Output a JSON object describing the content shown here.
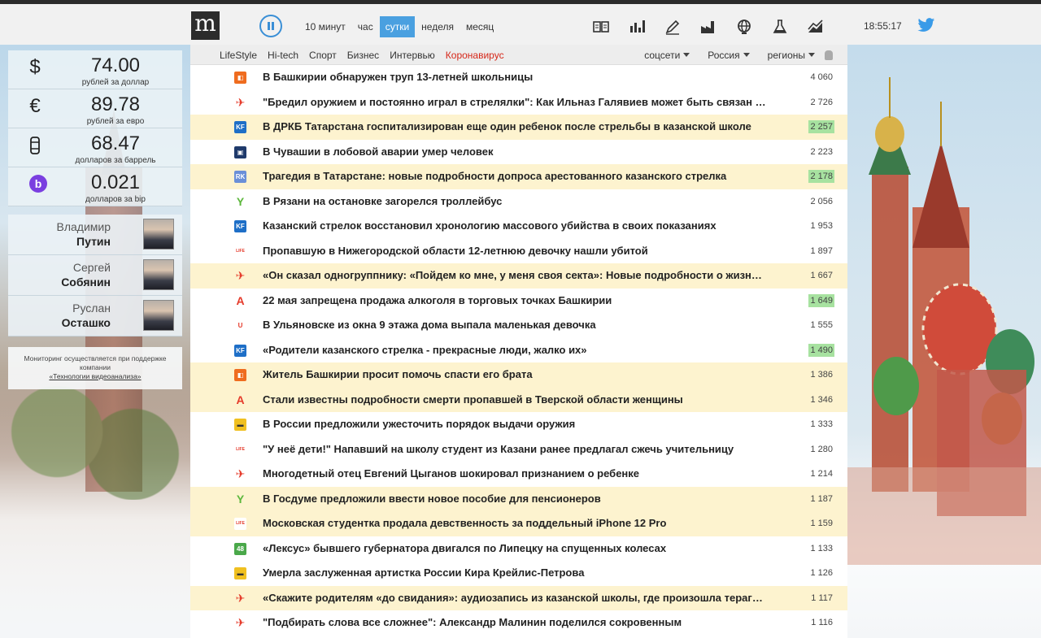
{
  "topbar": {
    "logo": "m",
    "periods": [
      "10 минут",
      "час",
      "сутки",
      "неделя",
      "месяц"
    ],
    "active_period": "сутки",
    "category_icons": [
      "newspaper-icon",
      "chart-bars-icon",
      "pen-icon",
      "factory-icon",
      "globe-icon",
      "flask-icon",
      "trend-icon"
    ],
    "time": "18:55:17"
  },
  "rates": [
    {
      "icon": "dollar",
      "symbol": "$",
      "value": "74.00",
      "caption": "рублей за доллар"
    },
    {
      "icon": "euro",
      "symbol": "€",
      "value": "89.78",
      "caption": "рублей за евро"
    },
    {
      "icon": "barrel",
      "symbol": "🛢",
      "value": "68.47",
      "caption": "долларов за баррель"
    },
    {
      "icon": "bip",
      "symbol": "b",
      "value": "0.021",
      "caption": "долларов за bip"
    }
  ],
  "people": [
    {
      "first": "Владимир",
      "last": "Путин"
    },
    {
      "first": "Сергей",
      "last": "Собянин"
    },
    {
      "first": "Руслан",
      "last": "Осташко"
    }
  ],
  "support": {
    "text": "Мониторинг осуществляется при поддержке компании",
    "link": "«Технологии видеоанализа»"
  },
  "subnav": {
    "categories": [
      "LifeStyle",
      "Hi-tech",
      "Спорт",
      "Бизнес",
      "Интервью"
    ],
    "highlight": "Коронавирус",
    "filters": [
      "соцсети",
      "Россия",
      "регионы"
    ]
  },
  "colors": {
    "accent": "#4aa0e0",
    "highlight_row": "#fdf3cf",
    "count_badge": "#a7e2a0",
    "hot": "#d6281a"
  },
  "news": [
    {
      "source": "square-orange",
      "title": "В Башкирии обнаружен труп 13-летней школьницы",
      "count": "4 060",
      "hl": false,
      "green": false
    },
    {
      "source": "bird-red",
      "title": "\"Бредил оружием и постоянно играл в стрелялки\": Как Ильназ Галявиев может быть связан со…",
      "count": "2 726",
      "hl": false,
      "green": false
    },
    {
      "source": "kf",
      "title": "В ДРКБ Татарстана госпитализирован еще один ребенок после стрельбы в казанской школе",
      "count": "2 257",
      "hl": true,
      "green": true
    },
    {
      "source": "save",
      "title": "В Чувашии в лобовой аварии умер человек",
      "count": "2 223",
      "hl": false,
      "green": false
    },
    {
      "source": "rk",
      "title": "Трагедия в Татарстане: новые подробности допроса арестованного казанского стрелка",
      "count": "2 178",
      "hl": true,
      "green": true
    },
    {
      "source": "y-green",
      "title": "В Рязани на остановке загорелся троллейбус",
      "count": "2 056",
      "hl": false,
      "green": false
    },
    {
      "source": "kf",
      "title": "Казанский стрелок восстановил хронологию массового убийства в своих показаниях",
      "count": "1 953",
      "hl": false,
      "green": false
    },
    {
      "source": "life",
      "title": "Пропавшую в Нижегородской области 12-летнюю девочку нашли убитой",
      "count": "1 897",
      "hl": false,
      "green": false
    },
    {
      "source": "bird-red",
      "title": "«Он сказал одногруппнику: «Пойдем ко мне, у меня своя секта»: Новые подробности о жизни …",
      "count": "1 667",
      "hl": true,
      "green": false
    },
    {
      "source": "a-red",
      "title": "22 мая запрещена продажа алкоголя в торговых точках Башкирии",
      "count": "1 649",
      "hl": false,
      "green": true
    },
    {
      "source": "u-red",
      "title": "В Ульяновске из окна 9 этажа дома выпала маленькая девочка",
      "count": "1 555",
      "hl": false,
      "green": false
    },
    {
      "source": "kf",
      "title": "«Родители казанского стрелка - прекрасные люди, жалко их»",
      "count": "1 490",
      "hl": false,
      "green": true
    },
    {
      "source": "square-orange",
      "title": "Житель Башкирии просит помочь спасти его брата",
      "count": "1 386",
      "hl": true,
      "green": false
    },
    {
      "source": "a-red",
      "title": "Стали известны подробности смерти пропавшей в Тверской области женщины",
      "count": "1 346",
      "hl": true,
      "green": false
    },
    {
      "source": "yellow-car",
      "title": "В России предложили ужесточить порядок выдачи оружия",
      "count": "1 333",
      "hl": false,
      "green": false
    },
    {
      "source": "life",
      "title": "\"У неё дети!\" Напавший на школу студент из Казани ранее предлагал сжечь учительницу",
      "count": "1 280",
      "hl": false,
      "green": false
    },
    {
      "source": "bird-red",
      "title": "Многодетный отец Евгений Цыганов шокировал признанием о ребенке",
      "count": "1 214",
      "hl": false,
      "green": false
    },
    {
      "source": "y-green",
      "title": "В Госдуме предложили ввести новое пособие для пенсионеров",
      "count": "1 187",
      "hl": true,
      "green": false
    },
    {
      "source": "life",
      "title": "Московская студентка продала девственность за поддельный iPhone 12 Pro",
      "count": "1 159",
      "hl": true,
      "green": false
    },
    {
      "source": "48",
      "title": "«Лексус» бывшего губернатора двигался по Липецку на спущенных колесах",
      "count": "1 133",
      "hl": false,
      "green": false
    },
    {
      "source": "yellow-car",
      "title": "Умерла заслуженная артистка России Кира Крейлис-Петрова",
      "count": "1 126",
      "hl": false,
      "green": false
    },
    {
      "source": "bird-red",
      "title": "«Скажите родителям «до свидания»: аудиозапись из казанской школы, где произошла терагед…",
      "count": "1 117",
      "hl": true,
      "green": false
    },
    {
      "source": "bird-red",
      "title": "\"Подбирать слова все сложнее\": Александр Малинин поделился сокровенным",
      "count": "1 116",
      "hl": false,
      "green": false
    }
  ]
}
